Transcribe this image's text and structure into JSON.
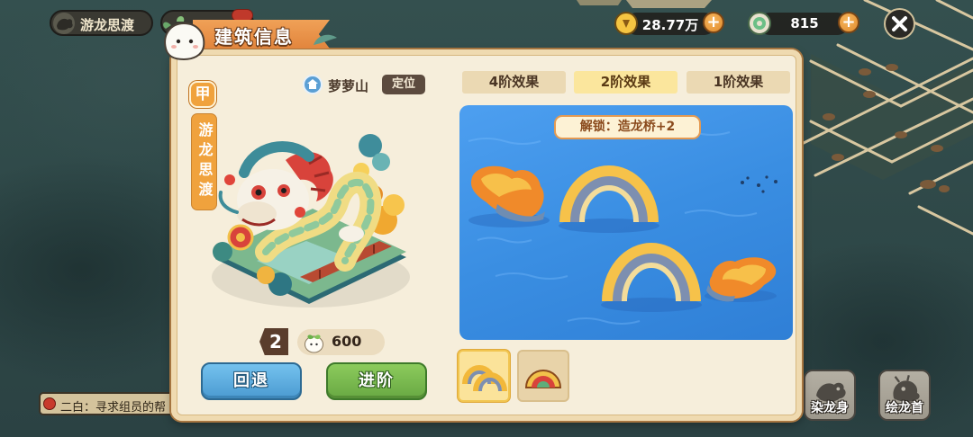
{
  "top_left": {
    "badge_icon": "dragon-icon",
    "badge_label": "游龙思渡"
  },
  "currencies": [
    {
      "icon": "gold-coin-icon",
      "value": "28.77万"
    },
    {
      "icon": "jade-coin-icon",
      "value": "815"
    }
  ],
  "panel": {
    "title": "建筑信息",
    "grade": "甲",
    "building_name": "游龙思渡",
    "location": {
      "icon": "location-icon",
      "name": "萝萝山",
      "button_label": "定位"
    },
    "level": "2",
    "cost": {
      "icon": "sprout-icon",
      "value": "600"
    },
    "back_label": "回退",
    "advance_label": "进阶",
    "tabs": [
      {
        "label": "4阶效果",
        "selected": false
      },
      {
        "label": "2阶效果",
        "selected": true
      },
      {
        "label": "1阶效果",
        "selected": false
      }
    ],
    "preview": {
      "unlock_label": "解锁：造龙桥+2"
    },
    "thumbnails": [
      {
        "icon": "dragon-bridge-icon",
        "selected": true
      },
      {
        "icon": "fan-bridge-icon",
        "selected": false
      }
    ]
  },
  "quest": {
    "text": "二白：寻求组员的帮"
  },
  "side_buttons": [
    {
      "icon": "dragon-body-icon",
      "label": "染龙身"
    },
    {
      "icon": "dragon-head-icon",
      "label": "绘龙首"
    }
  ],
  "colors": {
    "accent_orange": "#f0a23d",
    "selected_tab": "#fbe69d",
    "back_button": "#4b9ad1",
    "advance_button": "#68a843",
    "preview_water": "#3a8ee2"
  }
}
